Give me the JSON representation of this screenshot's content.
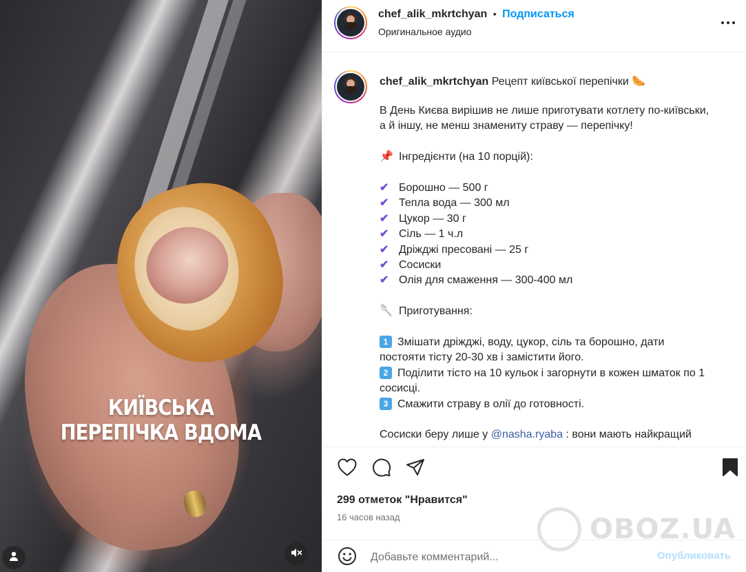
{
  "media": {
    "overlay_line1": "КИЇВСЬКА",
    "overlay_line2": "ПЕРЕПІЧКА ВДОМА",
    "user_icon": "user-icon",
    "mute_icon": "sound-off-icon"
  },
  "header": {
    "username": "chef_alik_mkrtchyan",
    "separator": "•",
    "follow_label": "Подписаться",
    "audio_label": "Оригинальное аудио",
    "more_icon": "more-icon"
  },
  "caption": {
    "username": "chef_alik_mkrtchyan",
    "title": "Рецепт київської перепічки 🌭",
    "intro_1": "В День Києва вирішив не лише приготувати котлету по-київськи,",
    "intro_2": "а й іншу, не менш знамениту страву — перепічку!",
    "ingredients_icon": "📌",
    "ingredients_heading": "Інгредієнти (на 10 порцій):",
    "check_icon": "✔",
    "ingredients": [
      "Борошно — 500 г",
      "Тепла вода — 300 мл",
      "Цукор — 30 г",
      "Сіль — 1 ч.л",
      "Дріжджі пресовані — 25 г",
      "Сосиски",
      "Олія для смаження — 300-400 мл"
    ],
    "steps_icon": "🥄",
    "steps_heading": "Приготування:",
    "steps": [
      {
        "num": "1",
        "line1": "Змішати дріжджі, воду, цукор, сіль та борошно, дати",
        "line2": "постояти тісту 20-30 хв і замістити його."
      },
      {
        "num": "2",
        "line1": "Поділити тісто на 10 кульок і загорнути в кожен шматок по 1",
        "line2": "сосисці."
      },
      {
        "num": "3",
        "line1": "Смажити страву в олії до готовності.",
        "line2": ""
      }
    ],
    "outro_before": "Сосиски беру лише у ",
    "outro_mention": "@nasha.ryaba",
    "outro_after": " : вони мають найкращий"
  },
  "actions": {
    "like_icon": "heart-icon",
    "comment_icon": "comment-icon",
    "share_icon": "share-icon",
    "save_icon": "bookmark-icon",
    "likes_text": "299 отметок \"Нравится\"",
    "time_text": "16 часов назад"
  },
  "comment": {
    "emoji_icon": "emoji-icon",
    "placeholder": "Добавьте комментарий...",
    "publish_label": "Опубликовать"
  },
  "watermark": {
    "text": "OBOZ.UA"
  }
}
